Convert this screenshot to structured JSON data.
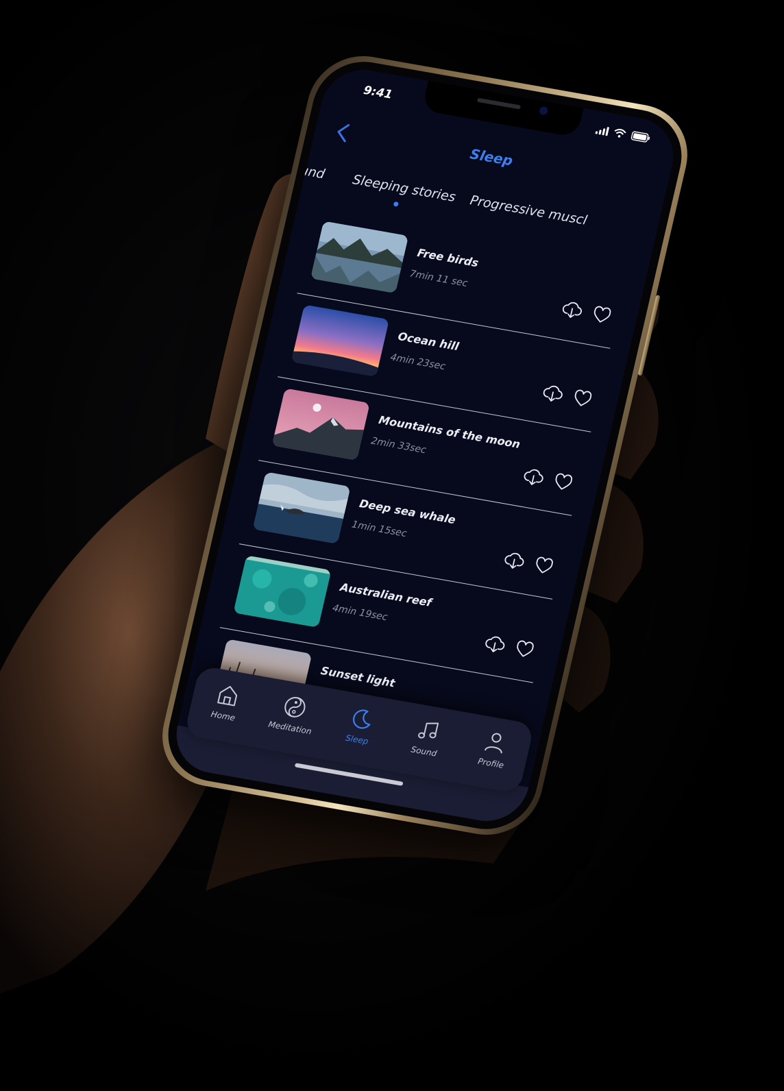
{
  "status_bar": {
    "time": "9:41"
  },
  "header": {
    "title": "Sleep"
  },
  "tabs": [
    {
      "label": "und"
    },
    {
      "label": "Sleeping stories",
      "active": true
    },
    {
      "label": "Progressive muscl"
    }
  ],
  "stories": [
    {
      "title": "Free birds",
      "duration": "7min 11 sec",
      "thumbnail": "mountain-lake"
    },
    {
      "title": "Ocean hill",
      "duration": "4min 23sec",
      "thumbnail": "ocean-sunset"
    },
    {
      "title": "Mountains of the moon",
      "duration": "2min 33sec",
      "thumbnail": "moon-mountain"
    },
    {
      "title": "Deep sea whale",
      "duration": "1min 15sec",
      "thumbnail": "whale-ocean"
    },
    {
      "title": "Australian reef",
      "duration": "4min 19sec",
      "thumbnail": "reef"
    },
    {
      "title": "Sunset light",
      "duration": "",
      "thumbnail": "sunset-grass"
    }
  ],
  "tabbar": [
    {
      "label": "Home",
      "icon": "home-icon"
    },
    {
      "label": "Meditation",
      "icon": "yin-yang-icon"
    },
    {
      "label": "Sleep",
      "icon": "moon-icon",
      "active": true
    },
    {
      "label": "Sound",
      "icon": "music-note-icon"
    },
    {
      "label": "Profile",
      "icon": "user-icon"
    }
  ],
  "colors": {
    "accent": "#3b7ff0",
    "screen_bg": "#070a1c",
    "tabbar_bg": "#1a1d33"
  }
}
